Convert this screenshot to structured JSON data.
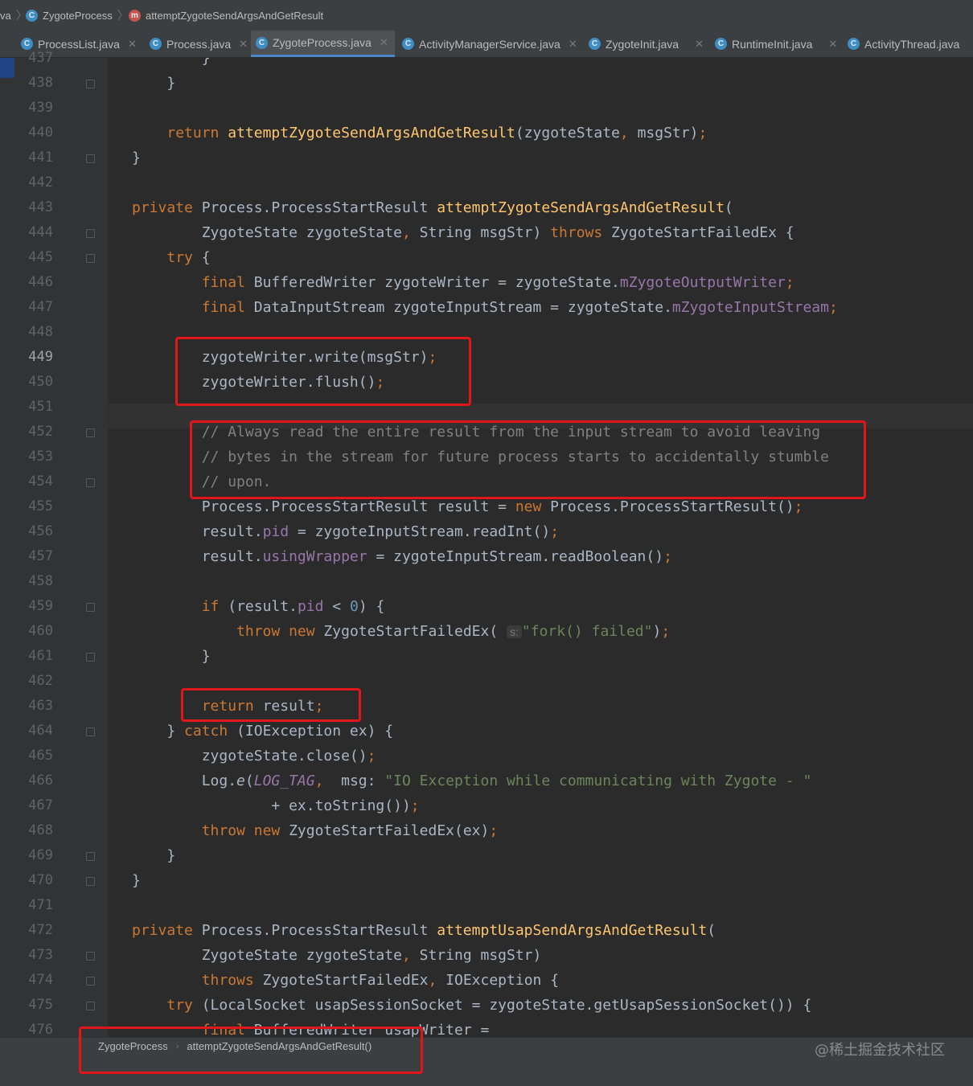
{
  "breadcrumb": {
    "lead": "va",
    "items": [
      {
        "icon": "class-icon",
        "label": "ZygoteProcess"
      },
      {
        "icon": "method-icon",
        "label": "attemptZygoteSendArgsAndGetResult"
      }
    ]
  },
  "tabs": [
    {
      "label": "ProcessList.java",
      "active": false
    },
    {
      "label": "Process.java",
      "active": false
    },
    {
      "label": "ZygoteProcess.java",
      "active": true
    },
    {
      "label": "ActivityManagerService.java",
      "active": false
    },
    {
      "label": "ZygoteInit.java",
      "active": false
    },
    {
      "label": "RuntimeInit.java",
      "active": false
    },
    {
      "label": "ActivityThread.java",
      "active": false
    }
  ],
  "editor": {
    "current_line": 449,
    "lines": [
      {
        "n": "437",
        "text": "        }"
      },
      {
        "n": "438",
        "text": "    }"
      },
      {
        "n": "439",
        "text": ""
      },
      {
        "n": "440",
        "text": "    return attemptZygoteSendArgsAndGetResult(zygoteState, msgStr);"
      },
      {
        "n": "441",
        "text": "}"
      },
      {
        "n": "442",
        "text": ""
      },
      {
        "n": "443",
        "text": "private Process.ProcessStartResult attemptZygoteSendArgsAndGetResult("
      },
      {
        "n": "444",
        "text": "        ZygoteState zygoteState, String msgStr) throws ZygoteStartFailedEx {"
      },
      {
        "n": "445",
        "text": "    try {"
      },
      {
        "n": "446",
        "text": "        final BufferedWriter zygoteWriter = zygoteState.mZygoteOutputWriter;"
      },
      {
        "n": "447",
        "text": "        final DataInputStream zygoteInputStream = zygoteState.mZygoteInputStream;"
      },
      {
        "n": "448",
        "text": ""
      },
      {
        "n": "449",
        "text": "        zygoteWriter.write(msgStr);"
      },
      {
        "n": "450",
        "text": "        zygoteWriter.flush();"
      },
      {
        "n": "451",
        "text": ""
      },
      {
        "n": "452",
        "text": "        // Always read the entire result from the input stream to avoid leaving"
      },
      {
        "n": "453",
        "text": "        // bytes in the stream for future process starts to accidentally stumble"
      },
      {
        "n": "454",
        "text": "        // upon."
      },
      {
        "n": "455",
        "text": "        Process.ProcessStartResult result = new Process.ProcessStartResult();"
      },
      {
        "n": "456",
        "text": "        result.pid = zygoteInputStream.readInt();"
      },
      {
        "n": "457",
        "text": "        result.usingWrapper = zygoteInputStream.readBoolean();"
      },
      {
        "n": "458",
        "text": ""
      },
      {
        "n": "459",
        "text": "        if (result.pid < 0) {"
      },
      {
        "n": "460",
        "text": "            throw new ZygoteStartFailedEx( s: \"fork() failed\");"
      },
      {
        "n": "461",
        "text": "        }"
      },
      {
        "n": "462",
        "text": ""
      },
      {
        "n": "463",
        "text": "        return result;"
      },
      {
        "n": "464",
        "text": "    } catch (IOException ex) {"
      },
      {
        "n": "465",
        "text": "        zygoteState.close();"
      },
      {
        "n": "466",
        "text": "        Log.e(LOG_TAG,  msg: \"IO Exception while communicating with Zygote - \""
      },
      {
        "n": "467",
        "text": "                + ex.toString());"
      },
      {
        "n": "468",
        "text": "        throw new ZygoteStartFailedEx(ex);"
      },
      {
        "n": "469",
        "text": "    }"
      },
      {
        "n": "470",
        "text": "}"
      },
      {
        "n": "471",
        "text": ""
      },
      {
        "n": "472",
        "text": "private Process.ProcessStartResult attemptUsapSendArgsAndGetResult("
      },
      {
        "n": "473",
        "text": "        ZygoteState zygoteState, String msgStr)"
      },
      {
        "n": "474",
        "text": "        throws ZygoteStartFailedEx, IOException {"
      },
      {
        "n": "475",
        "text": "    try (LocalSocket usapSessionSocket = zygoteState.getUsapSessionSocket()) {"
      },
      {
        "n": "476",
        "text": "        final BufferedWriter usapWriter ="
      }
    ]
  },
  "status": {
    "crumbs": [
      "ZygoteProcess",
      "attemptZygoteSendArgsAndGetResult()"
    ]
  },
  "watermark": "@稀土掘金技术社区",
  "colors": {
    "keyword": "#cc7832",
    "method": "#ffc66d",
    "field": "#9876aa",
    "comment": "#808080",
    "string": "#6a8759",
    "number": "#6897bb",
    "highlight_box": "#e0161b"
  }
}
